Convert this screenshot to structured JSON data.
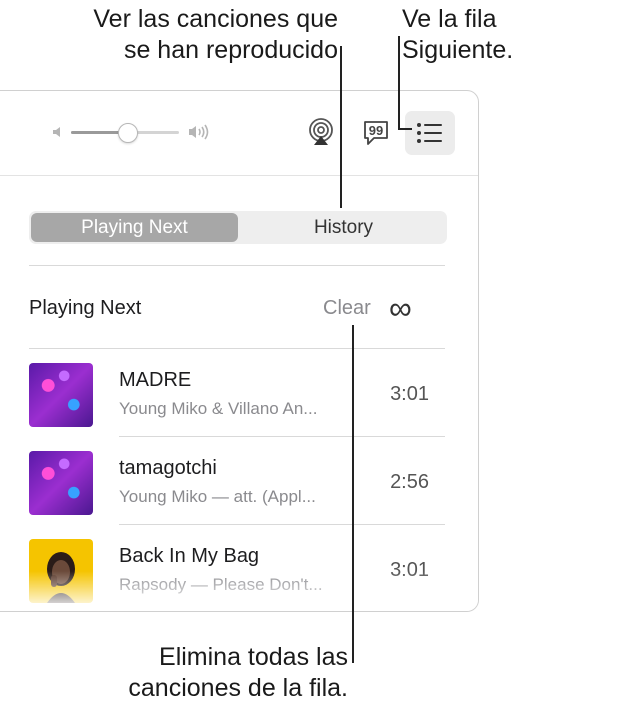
{
  "callouts": {
    "history": [
      "Ver las canciones que",
      "se han reproducido"
    ],
    "queue": [
      "Ve la fila",
      "Siguiente."
    ],
    "clear": [
      "Elimina todas las",
      "canciones de la fila."
    ]
  },
  "segmented": {
    "playing_next": "Playing Next",
    "history": "History"
  },
  "section": {
    "title": "Playing Next",
    "clear": "Clear",
    "autoplay_symbol": "∞"
  },
  "tracks": [
    {
      "title": "MADRE",
      "subtitle": "Young Miko & Villano An...",
      "duration": "3:01",
      "art": "purple-album-art"
    },
    {
      "title": "tamagotchi",
      "subtitle": "Young Miko — att. (Appl...",
      "duration": "2:56",
      "art": "purple-album-art"
    },
    {
      "title": "Back In My Bag",
      "subtitle": "Rapsody — Please Don't...",
      "duration": "3:01",
      "art": "yellow-album-art"
    }
  ],
  "volume": {
    "level": 0.52
  },
  "icons": {
    "volume_low": "speaker-low-icon",
    "volume_high": "speaker-high-icon",
    "airplay": "airplay-icon",
    "lyrics": "lyrics-icon",
    "queue": "list-icon"
  },
  "colors": {
    "active_segment": "#a7a7a7",
    "secondary_text": "#8a8a8e"
  }
}
